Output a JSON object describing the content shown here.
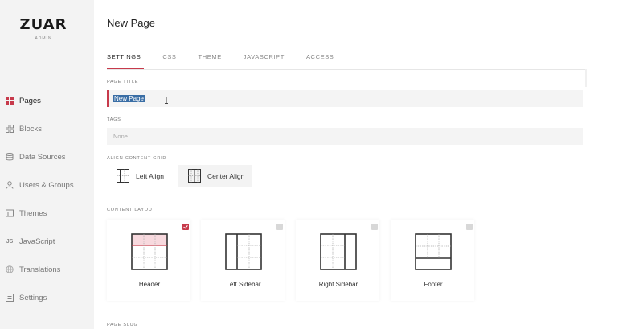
{
  "app": {
    "logo": "ZUAR",
    "logo_sub": "ADMIN"
  },
  "sidebar": {
    "items": [
      {
        "label": "Pages",
        "icon": "grid-icon",
        "active": true
      },
      {
        "label": "Blocks",
        "icon": "blocks-icon",
        "active": false
      },
      {
        "label": "Data Sources",
        "icon": "database-icon",
        "active": false
      },
      {
        "label": "Users & Groups",
        "icon": "user-icon",
        "active": false
      },
      {
        "label": "Themes",
        "icon": "theme-icon",
        "active": false
      },
      {
        "label": "JavaScript",
        "icon": "js-icon",
        "active": false
      },
      {
        "label": "Translations",
        "icon": "translate-icon",
        "active": false
      },
      {
        "label": "Settings",
        "icon": "settings-icon",
        "active": false
      }
    ]
  },
  "header": {
    "title": "New Page"
  },
  "tabs": [
    {
      "label": "SETTINGS",
      "active": true
    },
    {
      "label": "CSS",
      "active": false
    },
    {
      "label": "THEME",
      "active": false
    },
    {
      "label": "JAVASCRIPT",
      "active": false
    },
    {
      "label": "ACCESS",
      "active": false
    }
  ],
  "form": {
    "page_title_label": "PAGE TITLE",
    "page_title_value": "New Page",
    "tags_label": "TAGS",
    "tags_placeholder": "None",
    "align_label": "ALIGN CONTENT GRID",
    "align_options": [
      {
        "label": "Left Align",
        "selected": false
      },
      {
        "label": "Center Align",
        "selected": true
      }
    ],
    "layout_label": "CONTENT LAYOUT",
    "layouts": [
      {
        "label": "Header",
        "checked": true
      },
      {
        "label": "Left Sidebar",
        "checked": false
      },
      {
        "label": "Right Sidebar",
        "checked": false
      },
      {
        "label": "Footer",
        "checked": false
      }
    ],
    "slug_label": "PAGE SLUG"
  },
  "colors": {
    "accent": "#c73a4b",
    "sidebar_bg": "#f3f3f3",
    "input_bg": "#f4f4f4",
    "selection": "#3a6ea5"
  }
}
